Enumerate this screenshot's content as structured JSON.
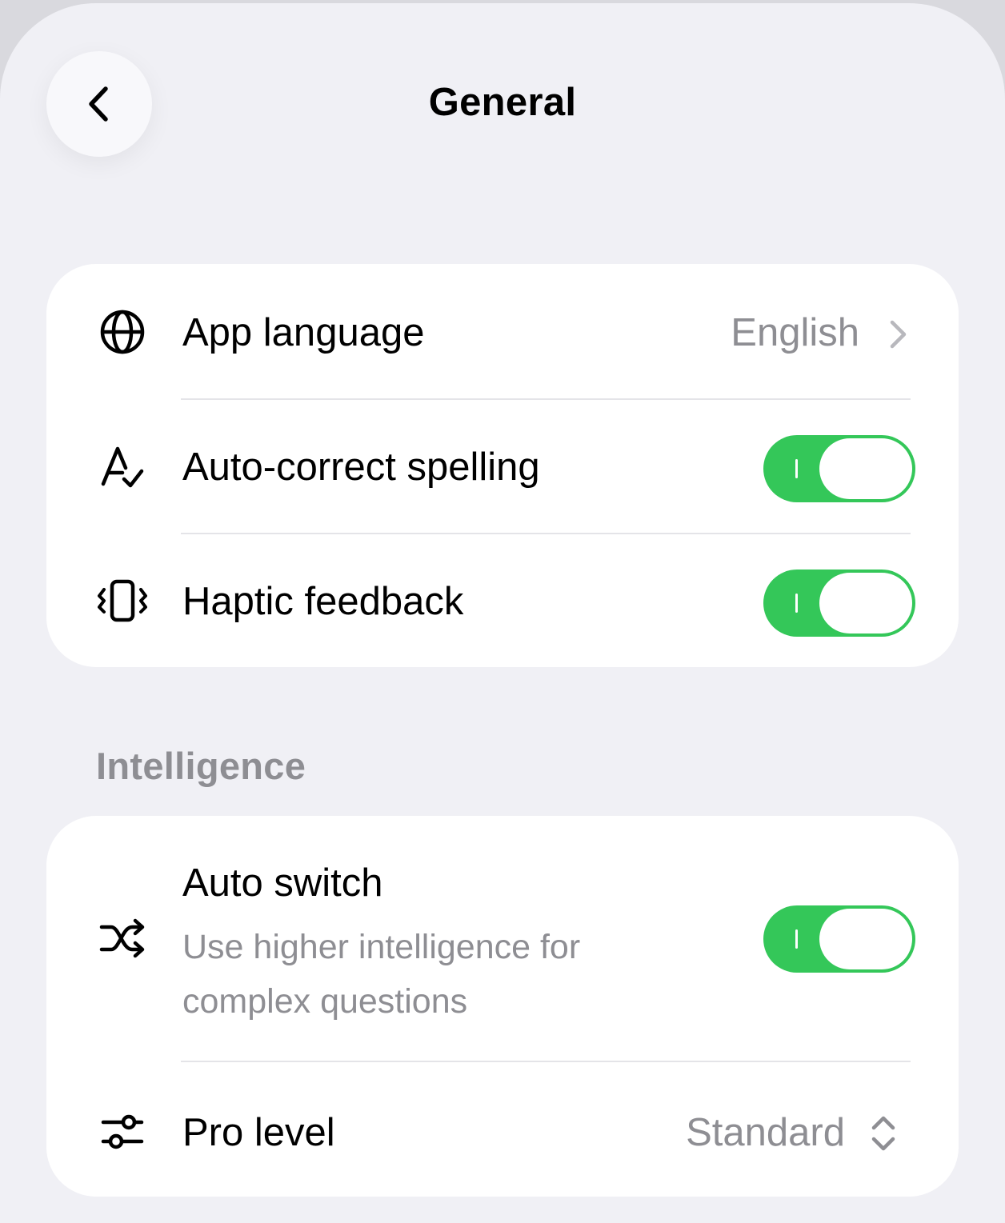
{
  "header": {
    "title": "General",
    "back_icon": "chevron-left-icon"
  },
  "general_settings": {
    "app_language": {
      "label": "App language",
      "value": "English",
      "icon": "globe-icon"
    },
    "auto_correct": {
      "label": "Auto-correct spelling",
      "enabled": true,
      "icon": "spellcheck-icon"
    },
    "haptic": {
      "label": "Haptic feedback",
      "enabled": true,
      "icon": "haptic-phone-icon"
    }
  },
  "intelligence": {
    "header": "Intelligence",
    "auto_switch": {
      "label": "Auto switch",
      "description": "Use higher intelligence for complex questions",
      "enabled": true,
      "icon": "shuffle-icon"
    },
    "pro_level": {
      "label": "Pro level",
      "value": "Standard",
      "icon": "sliders-icon"
    }
  },
  "colors": {
    "toggle_on": "#34c759",
    "background": "#f0f0f5",
    "secondary_text": "#8e8e93"
  }
}
